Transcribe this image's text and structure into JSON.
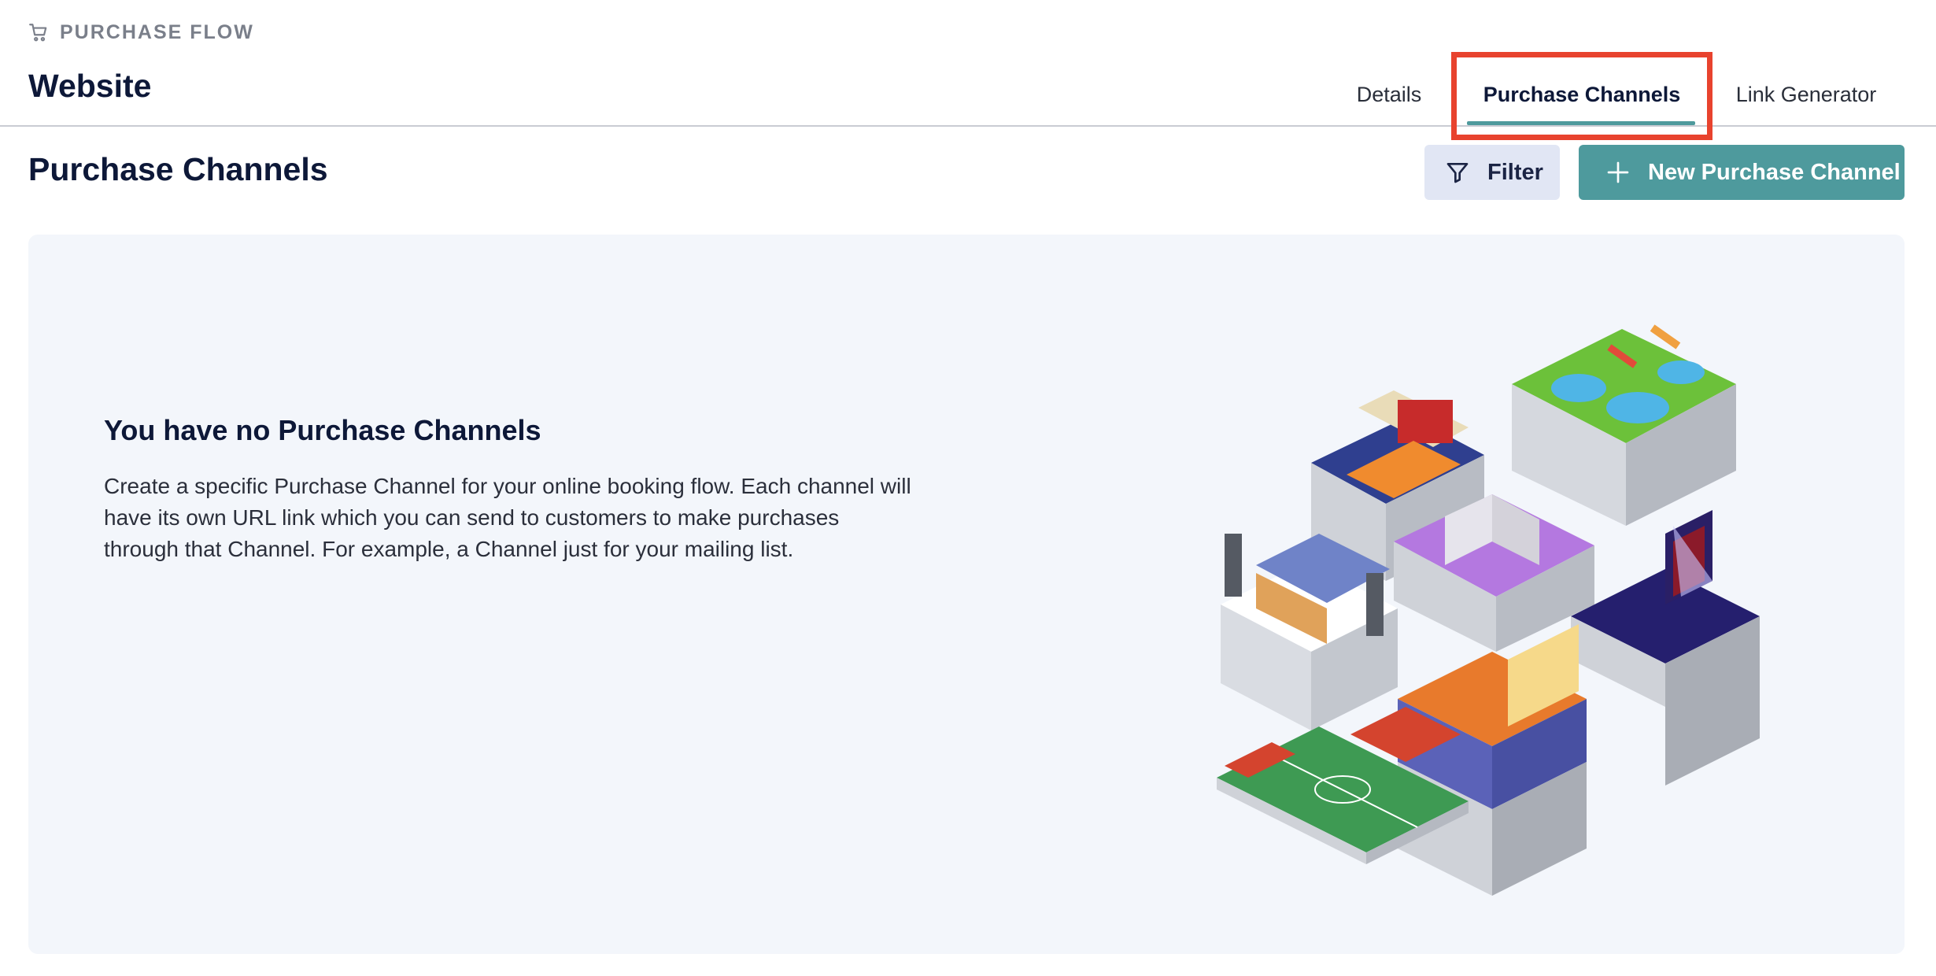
{
  "header": {
    "section_label": "PURCHASE FLOW",
    "section_icon": "cart-icon",
    "title": "Website"
  },
  "tabs": [
    {
      "label": "Details",
      "active": false
    },
    {
      "label": "Purchase Channels",
      "active": true
    },
    {
      "label": "Link Generator",
      "active": false
    }
  ],
  "toolbar": {
    "section_title": "Purchase Channels",
    "filter_label": "Filter",
    "filter_icon": "filter-icon",
    "new_label": "New Purchase Channel",
    "new_icon": "plus-icon"
  },
  "empty_state": {
    "title": "You have no Purchase Channels",
    "description": "Create a specific Purchase Channel for your online booking flow. Each channel will have its own URL link which you can send to customers to make purchases through that Channel. For example, a Channel just for your mailing list.",
    "illustration": "isometric-venues-illustration"
  },
  "colors": {
    "accent": "#4e9a9d",
    "highlight": "#e8432e",
    "filter_bg": "#e1e6f4",
    "card_bg": "#f3f6fb",
    "text_dark": "#0d1838"
  }
}
